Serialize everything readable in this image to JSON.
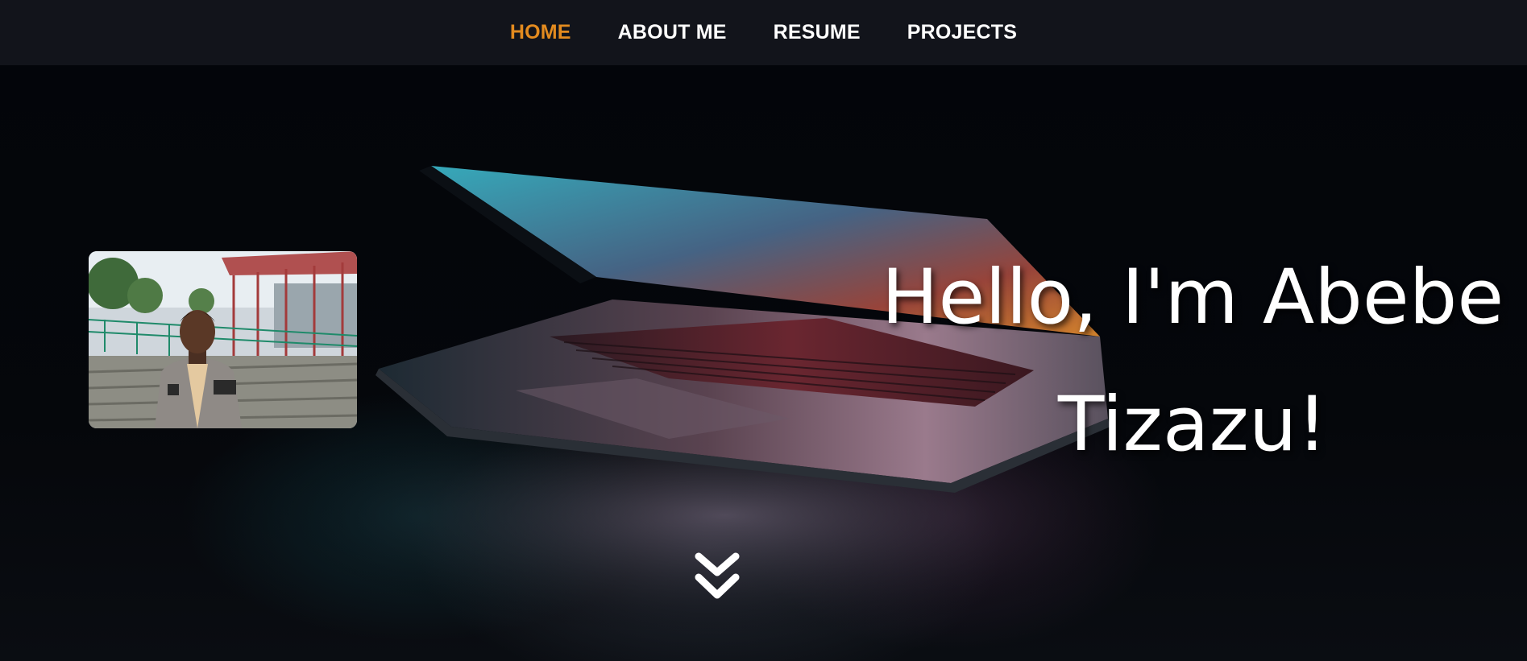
{
  "nav": {
    "items": [
      {
        "label": "HOME",
        "active": true
      },
      {
        "label": "ABOUT ME",
        "active": false
      },
      {
        "label": "RESUME",
        "active": false
      },
      {
        "label": "PROJECTS",
        "active": false
      }
    ]
  },
  "hero": {
    "title": "Hello, I'm Abebe Tizazu!",
    "background_image": "laptop-dark-image",
    "profile_image": "profile-photo",
    "scroll_icon": "chevron-double-down-icon"
  },
  "colors": {
    "nav_background": "#12141b",
    "nav_text": "#ffffff",
    "nav_active": "#e38b1f",
    "hero_text": "#ffffff"
  }
}
